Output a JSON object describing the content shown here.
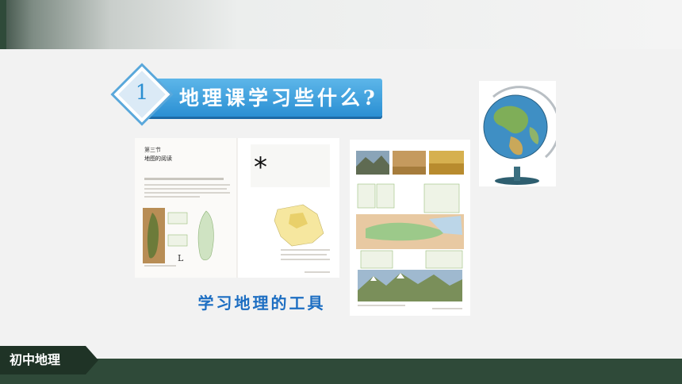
{
  "section": {
    "number": "1",
    "title": "地理课学习些什么?"
  },
  "caption": "学习地理的工具",
  "footer": {
    "subject": "初中地理"
  },
  "book_left": {
    "chapter": "第三节",
    "heading": "地图的阅读",
    "marker": "L"
  },
  "colors": {
    "ribbon": "#2a8fd3",
    "caption": "#1d6ec2",
    "footer_bg": "#2f4a39"
  }
}
